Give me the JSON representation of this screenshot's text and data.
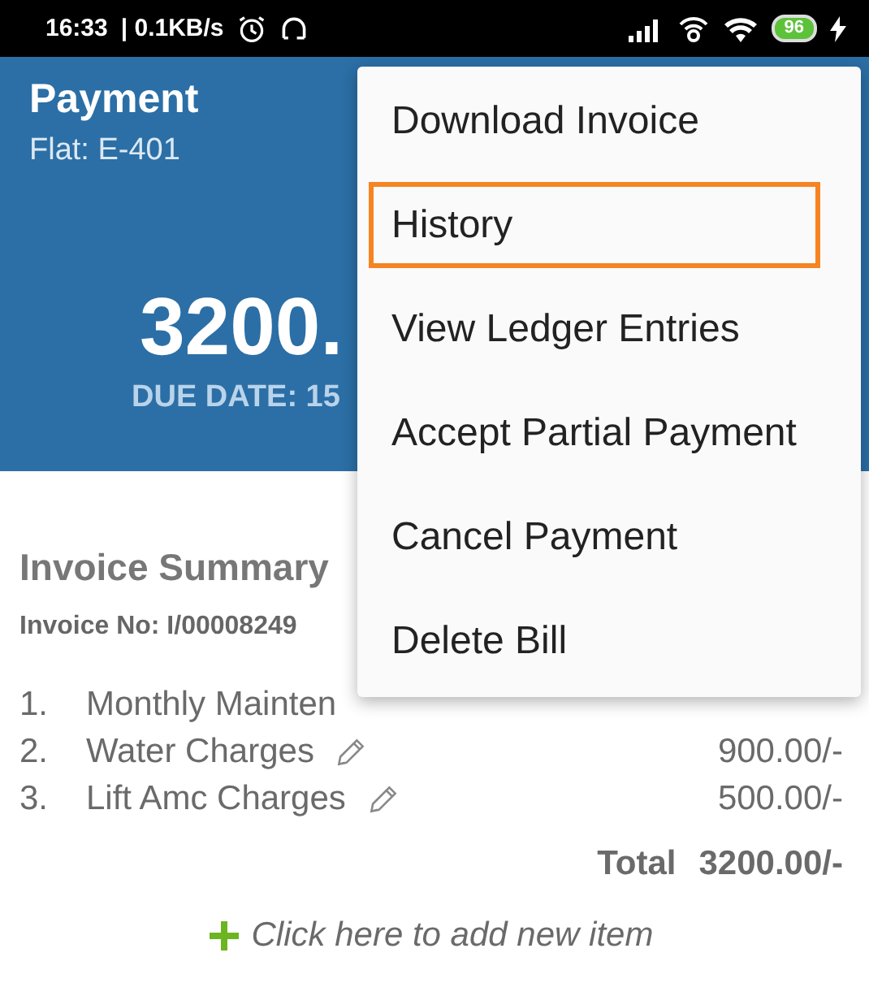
{
  "status_bar": {
    "time": "16:33",
    "speed": "| 0.1KB/s",
    "battery": "96"
  },
  "header": {
    "title": "Payment",
    "subtitle": "Flat: E-401",
    "amount": "3200.",
    "due": "DUE DATE: 15"
  },
  "menu": [
    {
      "label": "Download Invoice",
      "selected": false
    },
    {
      "label": "History",
      "selected": true
    },
    {
      "label": "View Ledger Entries",
      "selected": false
    },
    {
      "label": "Accept Partial Payment",
      "selected": false
    },
    {
      "label": "Cancel Payment",
      "selected": false
    },
    {
      "label": "Delete Bill",
      "selected": false
    }
  ],
  "summary": {
    "title": "Invoice Summary",
    "invoice_no": "Invoice No: I/00008249",
    "items": [
      {
        "index": "1.",
        "name": "Monthly Mainten"
      },
      {
        "index": "2.",
        "name": "Water Charges",
        "amount": "900.00/-"
      },
      {
        "index": "3.",
        "name": "Lift Amc Charges",
        "amount": "500.00/-"
      }
    ],
    "total_label": "Total",
    "total": "3200.00/-",
    "add_item": "Click here to add new item"
  }
}
